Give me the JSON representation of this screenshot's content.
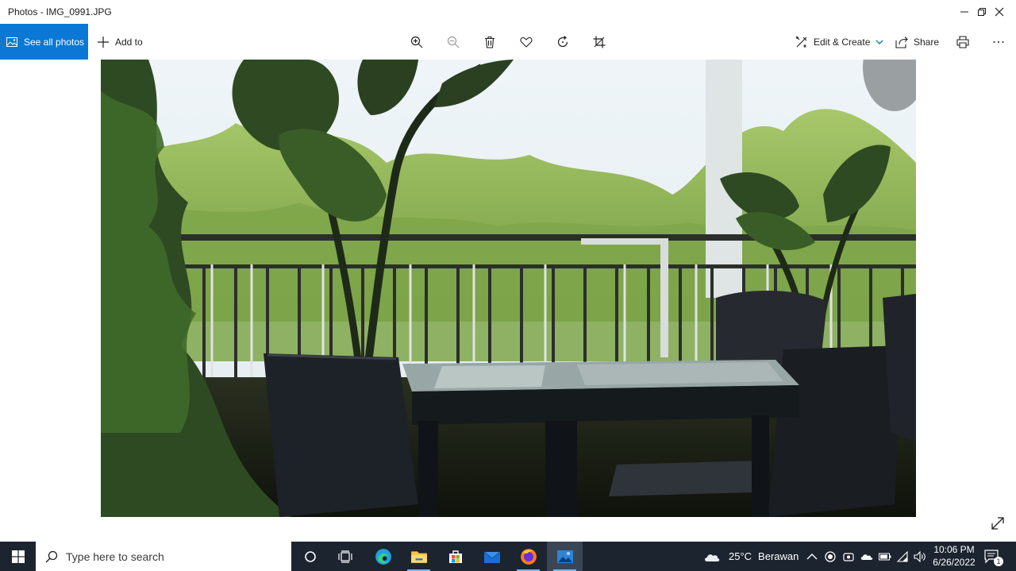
{
  "window": {
    "title": "Photos - IMG_0991.JPG"
  },
  "toolbar": {
    "see_all_label": "See all photos",
    "add_to_label": "Add to",
    "edit_create_label": "Edit & Create",
    "share_label": "Share"
  },
  "taskbar": {
    "search_placeholder": "Type here to search",
    "weather_temp": "25°C",
    "weather_desc": "Berawan",
    "time": "10:06 PM",
    "date": "6/26/2022",
    "notification_count": "1"
  },
  "icons": {
    "zoom_in": "zoom-in-icon",
    "zoom_out": "zoom-out-icon",
    "delete": "trash-icon",
    "favorite": "heart-icon",
    "rotate": "rotate-icon",
    "crop": "crop-icon",
    "print": "printer-icon",
    "more": "ellipsis-icon"
  },
  "colors": {
    "accent": "#0a78d4",
    "taskbar": "#1c2430"
  }
}
